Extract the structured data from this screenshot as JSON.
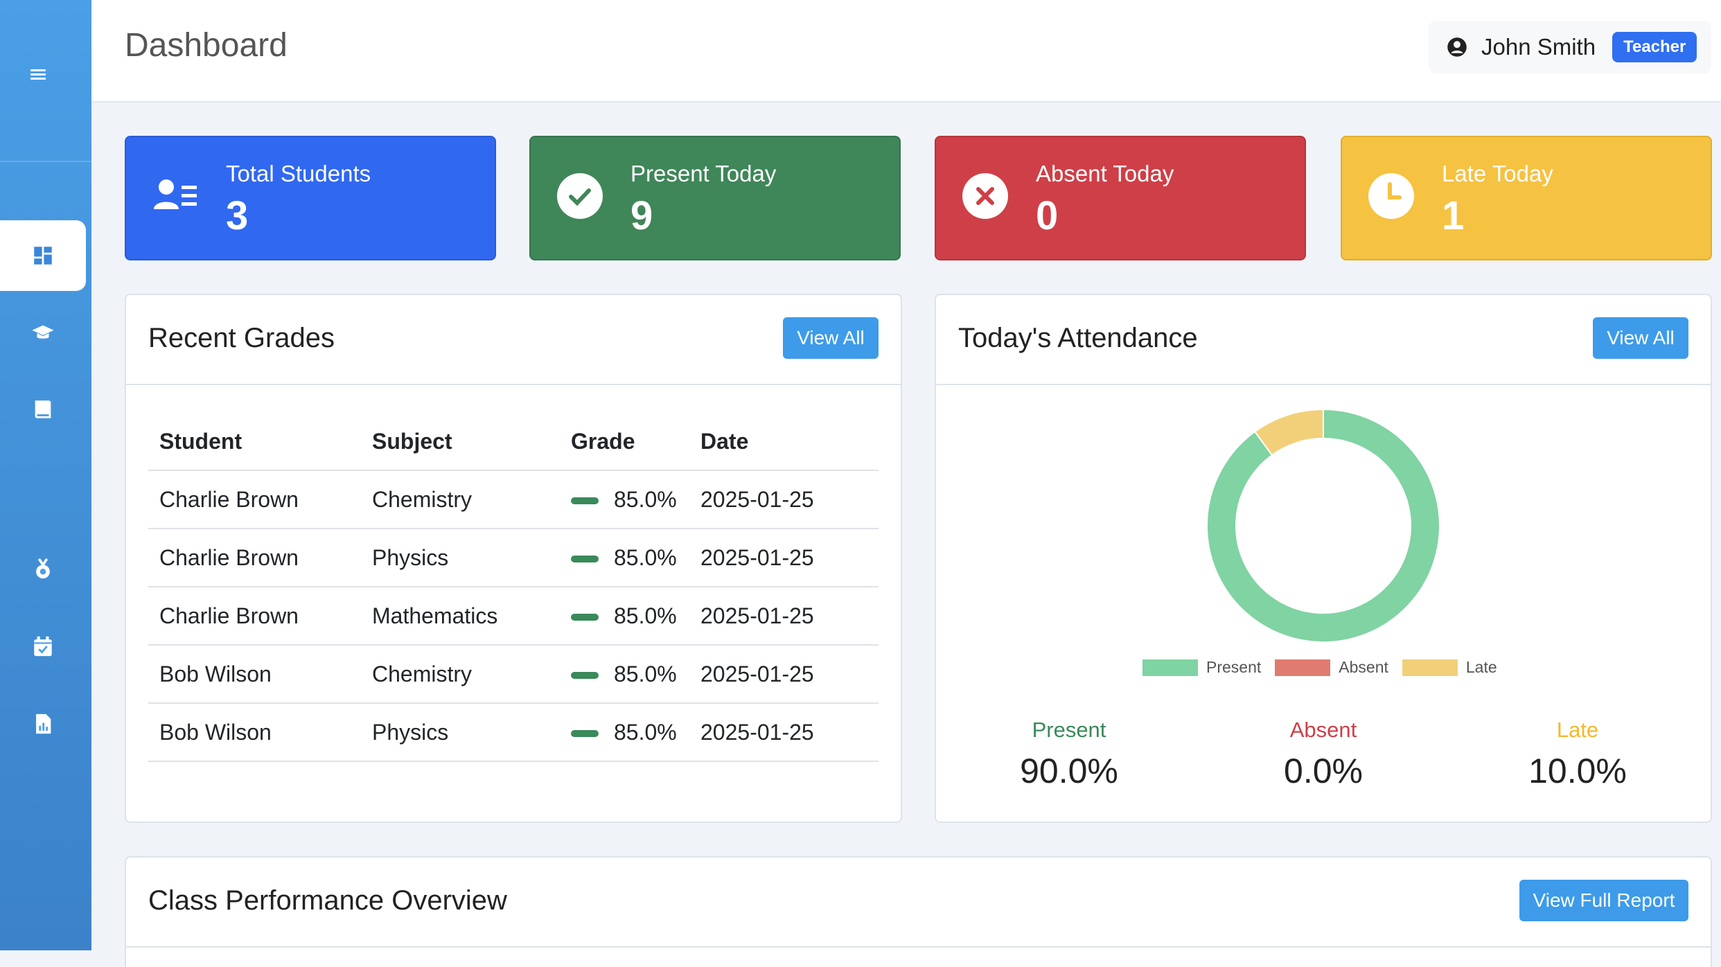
{
  "header": {
    "title": "Dashboard",
    "user_name": "John Smith",
    "role": "Teacher"
  },
  "sidebar": {
    "items": [
      {
        "icon": "dashboard-icon",
        "active": true
      },
      {
        "icon": "graduation-cap-icon"
      },
      {
        "icon": "book-icon"
      },
      {
        "icon": "medal-icon"
      },
      {
        "icon": "calendar-check-icon"
      },
      {
        "icon": "report-icon"
      }
    ]
  },
  "stats": [
    {
      "label": "Total Students",
      "value": "3",
      "color": "#3068f0",
      "icon": "students-icon"
    },
    {
      "label": "Present Today",
      "value": "9",
      "color": "#3f8659",
      "icon": "check-circle-icon"
    },
    {
      "label": "Absent Today",
      "value": "0",
      "color": "#cf3f47",
      "icon": "x-circle-icon"
    },
    {
      "label": "Late Today",
      "value": "1",
      "color": "#f5c242",
      "icon": "clock-icon"
    }
  ],
  "recent_grades": {
    "title": "Recent Grades",
    "button": "View All",
    "columns": [
      "Student",
      "Subject",
      "Grade",
      "Date"
    ],
    "rows": [
      {
        "student": "Charlie Brown",
        "subject": "Chemistry",
        "grade": "85.0%",
        "grade_value": 85.0,
        "date": "2025-01-25"
      },
      {
        "student": "Charlie Brown",
        "subject": "Physics",
        "grade": "85.0%",
        "grade_value": 85.0,
        "date": "2025-01-25"
      },
      {
        "student": "Charlie Brown",
        "subject": "Mathematics",
        "grade": "85.0%",
        "grade_value": 85.0,
        "date": "2025-01-25"
      },
      {
        "student": "Bob Wilson",
        "subject": "Chemistry",
        "grade": "85.0%",
        "grade_value": 85.0,
        "date": "2025-01-25"
      },
      {
        "student": "Bob Wilson",
        "subject": "Physics",
        "grade": "85.0%",
        "grade_value": 85.0,
        "date": "2025-01-25"
      }
    ]
  },
  "attendance": {
    "title": "Today's Attendance",
    "button": "View All",
    "stats": [
      {
        "label": "Present",
        "value": "90.0%",
        "color": "#3a8a5a"
      },
      {
        "label": "Absent",
        "value": "0.0%",
        "color": "#cf3f47"
      },
      {
        "label": "Late",
        "value": "10.0%",
        "color": "#f5b72c"
      }
    ]
  },
  "chart_data": {
    "type": "pie",
    "donut": true,
    "categories": [
      "Present",
      "Absent",
      "Late"
    ],
    "values": [
      90.0,
      0.0,
      10.0
    ],
    "colors": [
      "#80d3a2",
      "#e07b6f",
      "#f2d07a"
    ],
    "legend": "bottom"
  },
  "performance": {
    "title": "Class Performance Overview",
    "button": "View Full Report"
  }
}
